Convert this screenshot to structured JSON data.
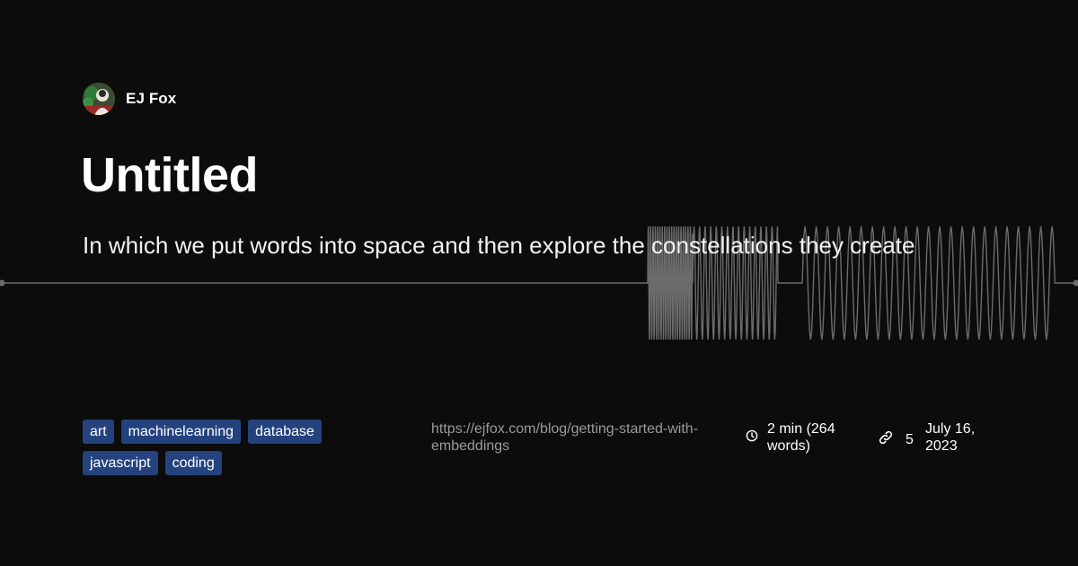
{
  "author": {
    "name": "EJ Fox",
    "avatar_icon": "avatar-icon"
  },
  "post": {
    "title": "Untitled",
    "subtitle": "In which we put words into space and then explore the constellations they create",
    "tags": [
      "art",
      "machinelearning",
      "database",
      "javascript",
      "coding"
    ],
    "url": "https://ejfox.com/blog/getting-started-with-embeddings",
    "reading_time": "2 min (264 words)",
    "link_count": "5",
    "date": "July 16, 2023"
  },
  "icons": {
    "time": "clock-icon",
    "links": "link-icon"
  },
  "colors": {
    "background": "#0c0c0c",
    "tag_bg": "#24427e",
    "wave": "#6b6b6b",
    "url": "#9a9a9a"
  }
}
